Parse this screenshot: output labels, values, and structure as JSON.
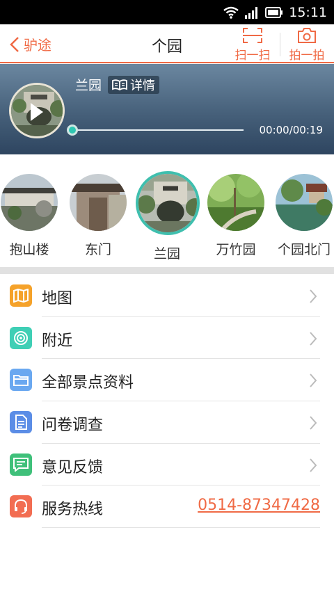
{
  "status_bar": {
    "time": "15:11"
  },
  "header": {
    "back_label": "驴途",
    "title": "个园",
    "scan_label": "扫一扫",
    "photo_label": "拍一拍"
  },
  "player": {
    "title": "兰园",
    "detail_label": "详情",
    "time": "00:00/00:19",
    "progress": 0
  },
  "spots": [
    {
      "label": "抱山楼",
      "active": false
    },
    {
      "label": "东门",
      "active": false
    },
    {
      "label": "兰园",
      "active": true
    },
    {
      "label": "万竹园",
      "active": false
    },
    {
      "label": "个园北门",
      "active": false
    }
  ],
  "menu": [
    {
      "label": "地图",
      "icon": "map-icon",
      "color": "#f5a22a"
    },
    {
      "label": "附近",
      "icon": "target-icon",
      "color": "#3fcfb5"
    },
    {
      "label": "全部景点资料",
      "icon": "folder-icon",
      "color": "#6aa8f0"
    },
    {
      "label": "问卷调查",
      "icon": "document-icon",
      "color": "#5b8de6"
    },
    {
      "label": "意见反馈",
      "icon": "chat-icon",
      "color": "#3fc07a"
    },
    {
      "label": "服务热线",
      "icon": "headset-icon",
      "color": "#f26d52",
      "value": "0514-87347428"
    }
  ],
  "colors": {
    "accent": "#f06a45",
    "teal": "#3fbfae"
  }
}
